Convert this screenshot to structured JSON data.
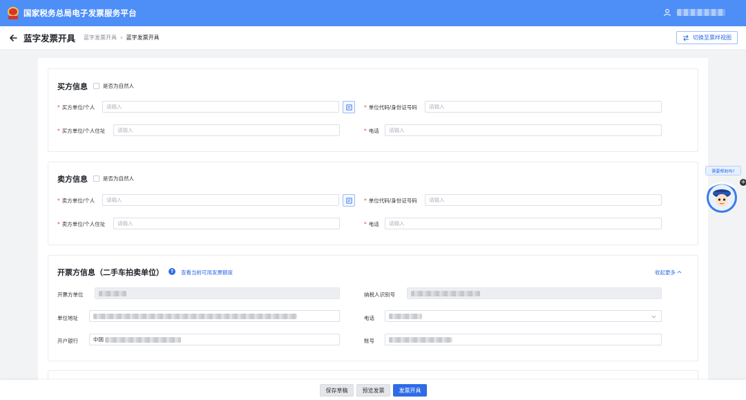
{
  "app": {
    "title": "国家税务总局电子发票服务平台"
  },
  "header": {
    "page_title": "蓝字发票开具",
    "breadcrumb": [
      "蓝字发票开具",
      "蓝字发票开具"
    ],
    "switch_label": "切换至票样视图"
  },
  "buyer": {
    "title": "买方信息",
    "natural_person": "是否为自然人",
    "name_label": "买方单位/个人",
    "name_placeholder": "请输入",
    "code_label": "单位代码/身份证号码",
    "code_placeholder": "请输入",
    "address_label": "买方单位/个人住址",
    "address_placeholder": "请输入",
    "phone_label": "电话",
    "phone_placeholder": "请输入"
  },
  "seller": {
    "title": "卖方信息",
    "natural_person": "是否为自然人",
    "name_label": "卖方单位/个人",
    "name_placeholder": "请输入",
    "code_label": "单位代码/身份证号码",
    "code_placeholder": "请输入",
    "address_label": "卖方单位/个人住址",
    "address_placeholder": "请输入",
    "phone_label": "电话",
    "phone_placeholder": "请输入"
  },
  "issuer": {
    "title": "开票方信息（二手车拍卖单位）",
    "quota_link": "查看当前可用发票额度",
    "collapse": "收起更多",
    "unit_label": "开票方单位",
    "taxid_label": "纳税人识别号",
    "address_label": "单位地址",
    "phone_label": "电话",
    "bank_label": "开户银行",
    "bank_value_prefix": "中国",
    "account_label": "账号"
  },
  "assistant": {
    "bubble": "需要帮助吗?"
  },
  "footer": {
    "save_draft": "保存草稿",
    "preview": "预览发票",
    "issue": "发票开具"
  },
  "colors": {
    "brand": "#4d8ef7",
    "primary": "#2e6be6",
    "required": "#e5484d"
  }
}
